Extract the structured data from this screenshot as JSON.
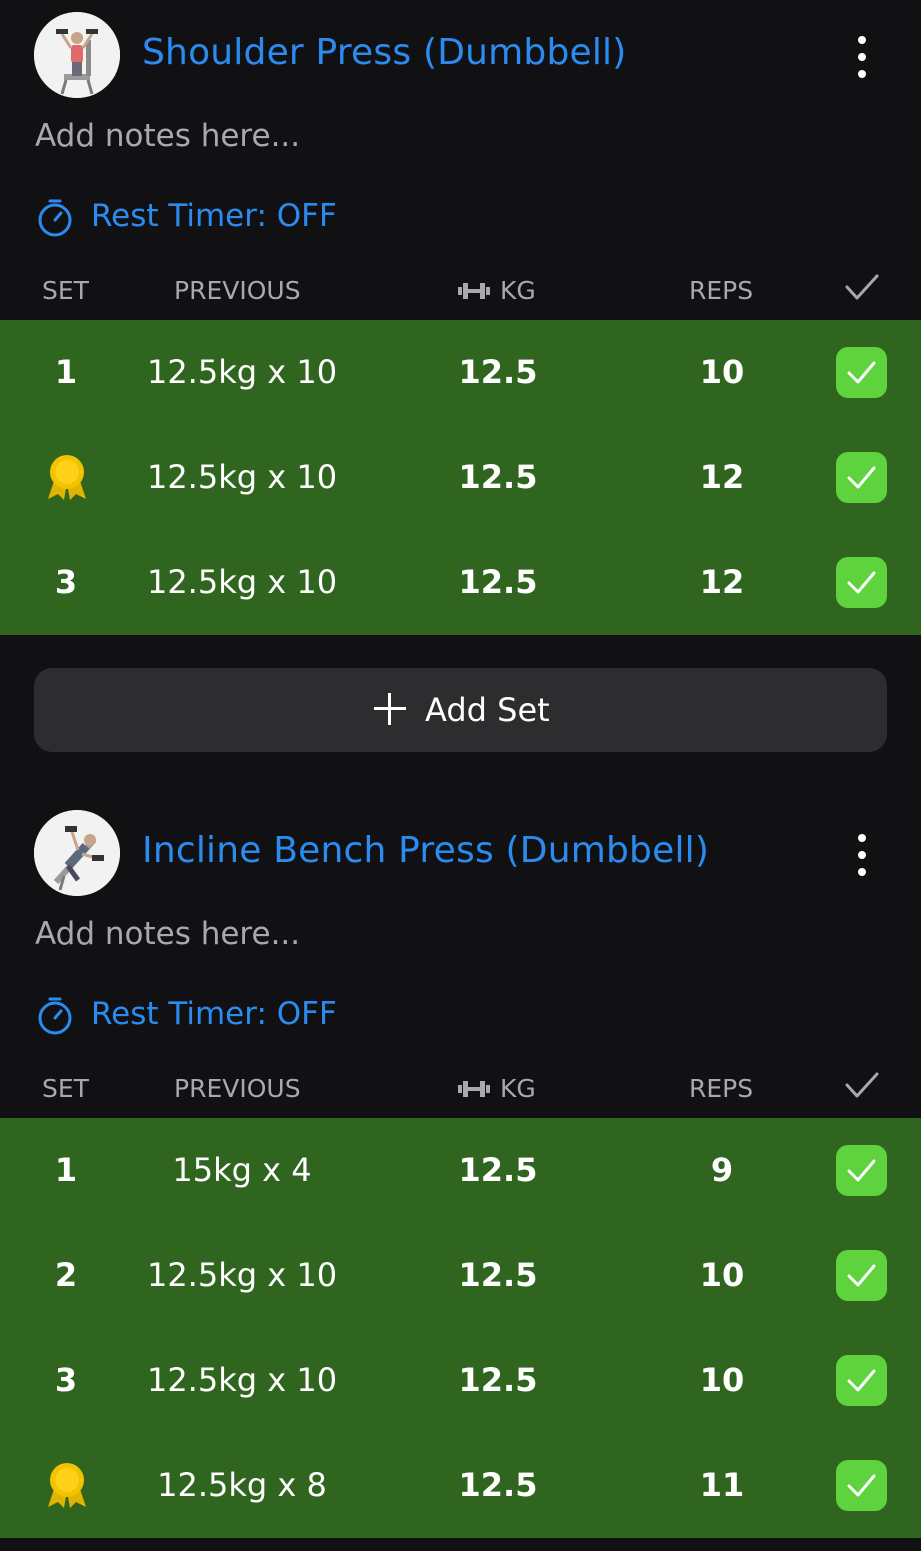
{
  "colors": {
    "background": "#111113",
    "accent": "#2a8cf0",
    "completed_row": "#30651f",
    "check_green": "#5fd33e",
    "button_bg": "#2d2d30",
    "muted_text": "#a9a9ad"
  },
  "columns": {
    "set": "SET",
    "previous": "PREVIOUS",
    "kg": "KG",
    "reps": "REPS",
    "check_icon": "check-icon"
  },
  "exercises": [
    {
      "title": "Shoulder Press (Dumbbell)",
      "notes_placeholder": "Add notes here...",
      "rest_timer": "Rest Timer: OFF",
      "sets": [
        {
          "set": "1",
          "record_medal": false,
          "previous": "12.5kg x 10",
          "kg": "12.5",
          "reps": "10",
          "done": true
        },
        {
          "set": "",
          "record_medal": true,
          "previous": "12.5kg x 10",
          "kg": "12.5",
          "reps": "12",
          "done": true
        },
        {
          "set": "3",
          "record_medal": false,
          "previous": "12.5kg x 10",
          "kg": "12.5",
          "reps": "12",
          "done": true
        }
      ]
    },
    {
      "title": "Incline Bench Press (Dumbbell)",
      "notes_placeholder": "Add notes here...",
      "rest_timer": "Rest Timer: OFF",
      "sets": [
        {
          "set": "1",
          "record_medal": false,
          "previous": "15kg x 4",
          "kg": "12.5",
          "reps": "9",
          "done": true
        },
        {
          "set": "2",
          "record_medal": false,
          "previous": "12.5kg x 10",
          "kg": "12.5",
          "reps": "10",
          "done": true
        },
        {
          "set": "3",
          "record_medal": false,
          "previous": "12.5kg x 10",
          "kg": "12.5",
          "reps": "10",
          "done": true
        },
        {
          "set": "",
          "record_medal": true,
          "previous": "12.5kg x 8",
          "kg": "12.5",
          "reps": "11",
          "done": true
        }
      ]
    }
  ],
  "add_set_label": "Add Set"
}
